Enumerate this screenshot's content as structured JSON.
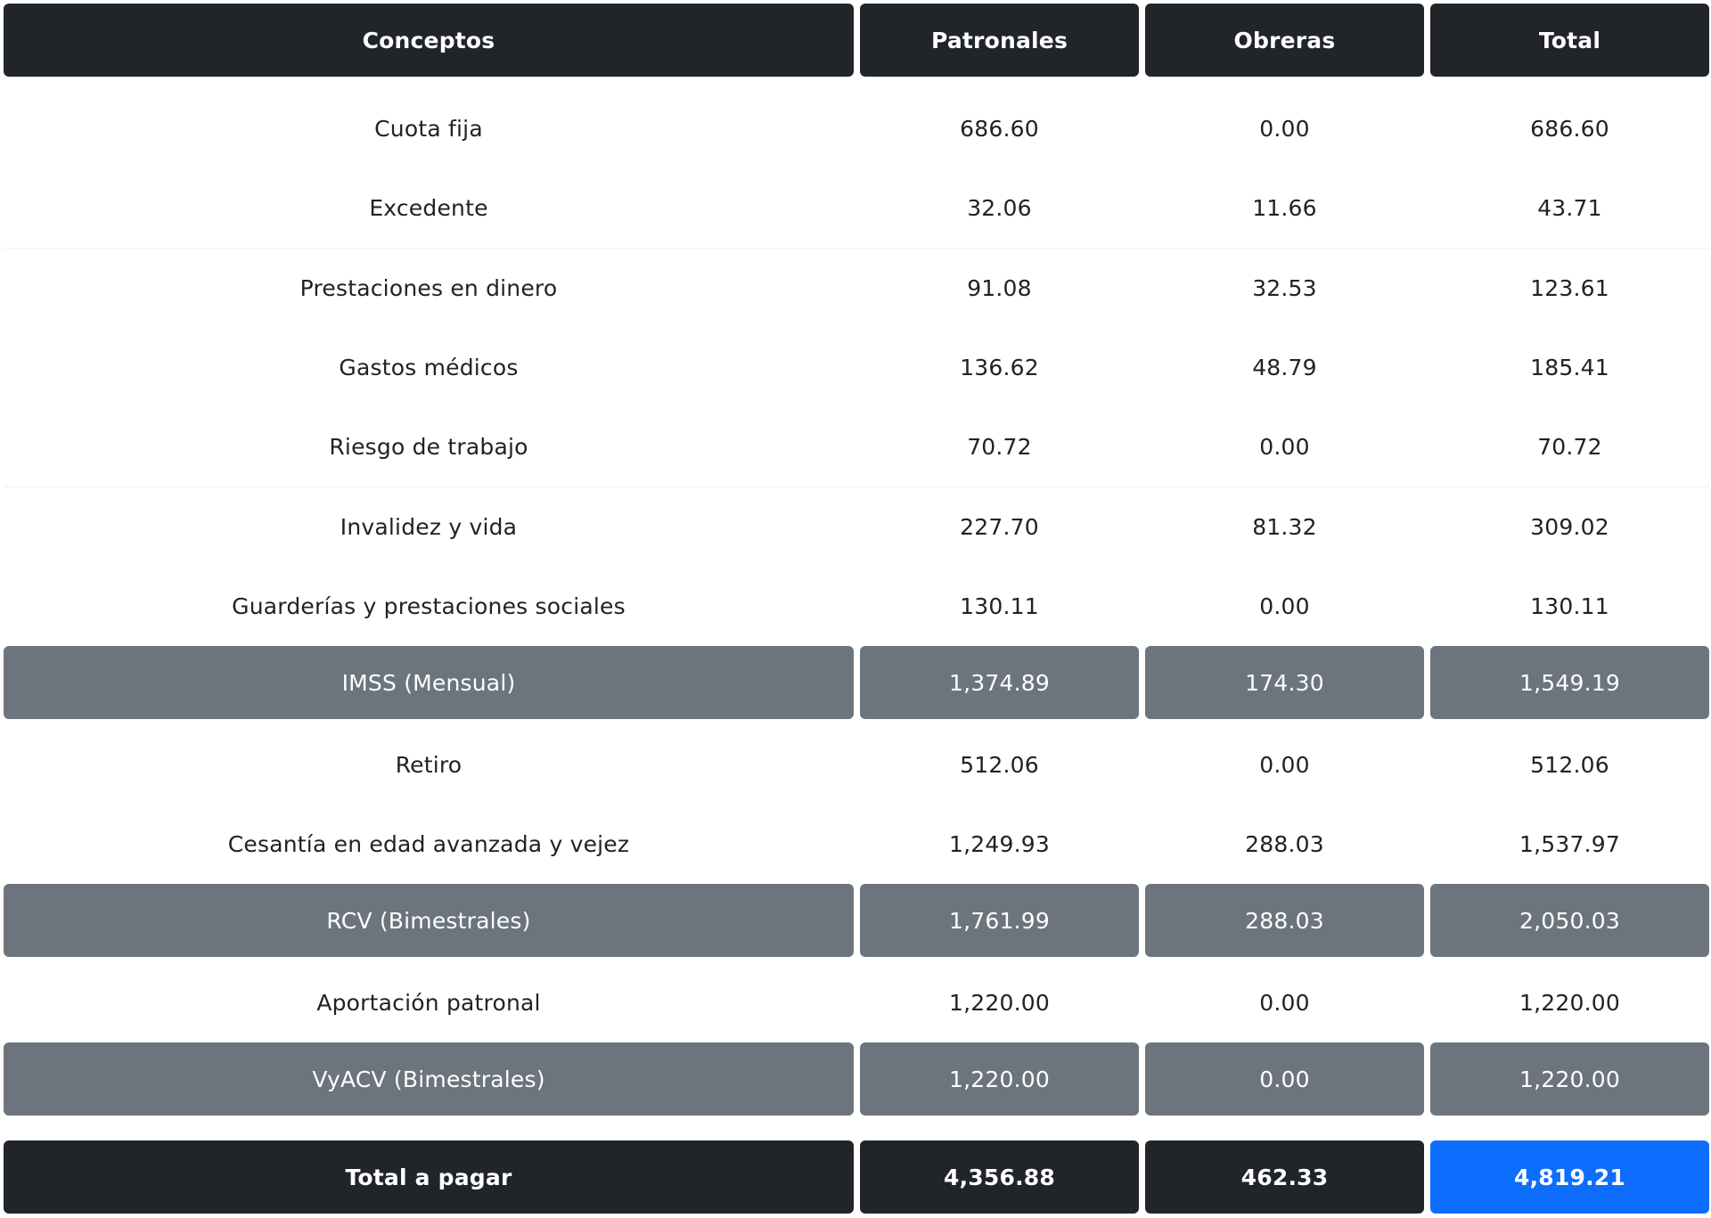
{
  "table": {
    "headers": {
      "concept": "Conceptos",
      "employer": "Patronales",
      "worker": "Obreras",
      "total": "Total"
    },
    "rows": [
      {
        "concept": "Cuota fija",
        "employer": "686.60",
        "worker": "0.00",
        "total": "686.60"
      },
      {
        "concept": "Excedente",
        "employer": "32.06",
        "worker": "11.66",
        "total": "43.71"
      },
      {
        "concept": "Prestaciones en dinero",
        "employer": "91.08",
        "worker": "32.53",
        "total": "123.61"
      },
      {
        "concept": "Gastos médicos",
        "employer": "136.62",
        "worker": "48.79",
        "total": "185.41"
      },
      {
        "concept": "Riesgo de trabajo",
        "employer": "70.72",
        "worker": "0.00",
        "total": "70.72"
      },
      {
        "concept": "Invalidez y vida",
        "employer": "227.70",
        "worker": "81.32",
        "total": "309.02"
      },
      {
        "concept": "Guarderías y prestaciones sociales",
        "employer": "130.11",
        "worker": "0.00",
        "total": "130.11"
      },
      {
        "concept": "IMSS (Mensual)",
        "employer": "1,374.89",
        "worker": "174.30",
        "total": "1,549.19",
        "subtotal": true
      },
      {
        "concept": "Retiro",
        "employer": "512.06",
        "worker": "0.00",
        "total": "512.06"
      },
      {
        "concept": "Cesantía en edad avanzada y vejez",
        "employer": "1,249.93",
        "worker": "288.03",
        "total": "1,537.97"
      },
      {
        "concept": "RCV (Bimestrales)",
        "employer": "1,761.99",
        "worker": "288.03",
        "total": "2,050.03",
        "subtotal": true
      },
      {
        "concept": "Aportación patronal",
        "employer": "1,220.00",
        "worker": "0.00",
        "total": "1,220.00"
      },
      {
        "concept": "VyACV (Bimestrales)",
        "employer": "1,220.00",
        "worker": "0.00",
        "total": "1,220.00",
        "subtotal": true
      }
    ],
    "grand_total": {
      "concept": "Total a pagar",
      "employer": "4,356.88",
      "worker": "462.33",
      "total": "4,819.21"
    }
  },
  "colors": {
    "header_bg": "#212529",
    "subtotal_bg": "#6c757d",
    "highlight_bg": "#0d6efd",
    "text_light": "#ffffff",
    "text_dark": "#222222"
  }
}
